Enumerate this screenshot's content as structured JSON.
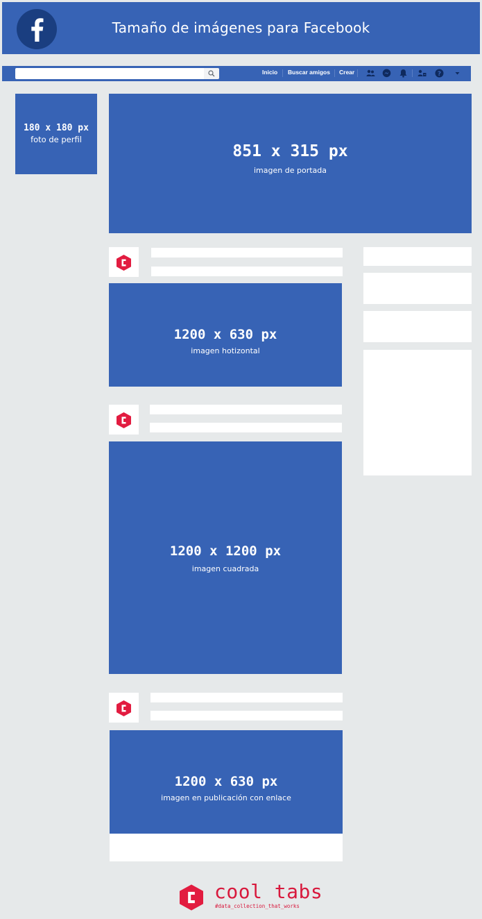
{
  "header": {
    "title": "Tamaño de imágenes para Facebook",
    "logo_icon": "facebook-logo-icon",
    "background": "#3763b5"
  },
  "navbar": {
    "search": {
      "value": "",
      "placeholder": "",
      "icon": "search-icon"
    },
    "links": [
      "Inicio",
      "Buscar amigos",
      "Crear"
    ],
    "icons": [
      "friends-icon",
      "messenger-icon",
      "bell-icon",
      "friend-requests-icon",
      "help-icon",
      "caret-down-icon"
    ]
  },
  "profile": {
    "size": "180 x 180 px",
    "label": "foto de perfil"
  },
  "cover": {
    "size": "851 x 315 px",
    "label": "imagen de portada"
  },
  "posts": [
    {
      "size": "1200 x 630 px",
      "label": "imagen hotizontal"
    },
    {
      "size": "1200 x 1200 px",
      "label": "imagen cuadrada"
    },
    {
      "size": "1200 x 630 px",
      "label": "imagen en publicación con enlace"
    }
  ],
  "footer": {
    "brand": "cool tabs",
    "tagline": "#data_collection_that_works",
    "logo_icon": "cooltabs-logo-icon",
    "brand_color": "#d8193d"
  },
  "colors": {
    "page_background": "#e6e9ea",
    "placeholder_blue": "#3763b5",
    "card_white": "#ffffff"
  }
}
